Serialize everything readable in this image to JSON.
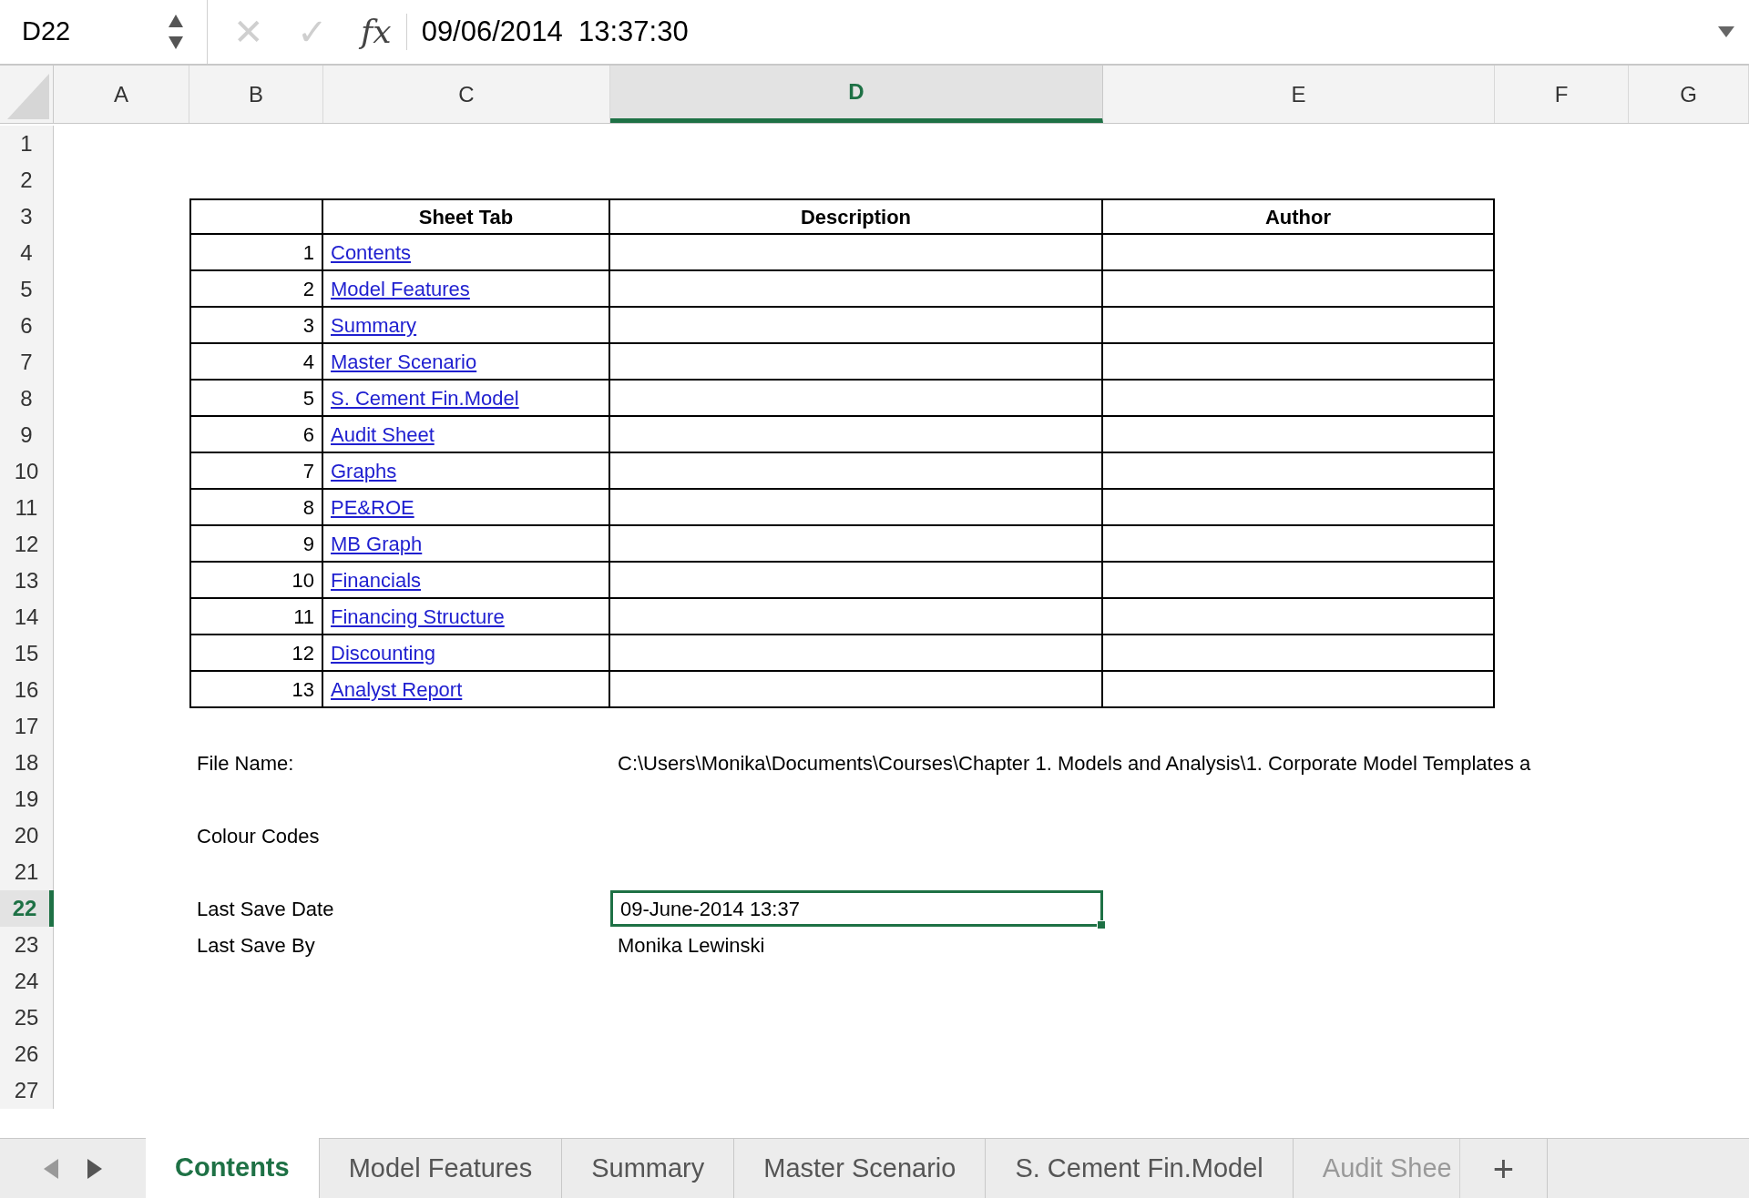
{
  "formula_bar": {
    "name_box": "D22",
    "cancel": "✕",
    "enter": "✓",
    "fx": "fx",
    "formula": "09/06/2014  13:37:30"
  },
  "columns": [
    {
      "label": "A",
      "selected": false
    },
    {
      "label": "B",
      "selected": false
    },
    {
      "label": "C",
      "selected": false
    },
    {
      "label": "D",
      "selected": true
    },
    {
      "label": "E",
      "selected": false
    },
    {
      "label": "F",
      "selected": false
    },
    {
      "label": "G",
      "selected": false
    }
  ],
  "row_numbers": [
    {
      "label": "1",
      "selected": false
    },
    {
      "label": "2",
      "selected": false
    },
    {
      "label": "3",
      "selected": false
    },
    {
      "label": "4",
      "selected": false
    },
    {
      "label": "5",
      "selected": false
    },
    {
      "label": "6",
      "selected": false
    },
    {
      "label": "7",
      "selected": false
    },
    {
      "label": "8",
      "selected": false
    },
    {
      "label": "9",
      "selected": false
    },
    {
      "label": "10",
      "selected": false
    },
    {
      "label": "11",
      "selected": false
    },
    {
      "label": "12",
      "selected": false
    },
    {
      "label": "13",
      "selected": false
    },
    {
      "label": "14",
      "selected": false
    },
    {
      "label": "15",
      "selected": false
    },
    {
      "label": "16",
      "selected": false
    },
    {
      "label": "17",
      "selected": false
    },
    {
      "label": "18",
      "selected": false
    },
    {
      "label": "19",
      "selected": false
    },
    {
      "label": "20",
      "selected": false
    },
    {
      "label": "21",
      "selected": false
    },
    {
      "label": "22",
      "selected": true
    },
    {
      "label": "23",
      "selected": false
    },
    {
      "label": "24",
      "selected": false
    },
    {
      "label": "25",
      "selected": false
    },
    {
      "label": "26",
      "selected": false
    },
    {
      "label": "27",
      "selected": false
    }
  ],
  "contents_table": {
    "headers": [
      "Sheet Tab",
      "Description",
      "Author"
    ],
    "rows": [
      {
        "number": "1",
        "sheet": "Contents"
      },
      {
        "number": "2",
        "sheet": "Model Features"
      },
      {
        "number": "3",
        "sheet": "Summary"
      },
      {
        "number": "4",
        "sheet": "Master Scenario"
      },
      {
        "number": "5",
        "sheet": "S. Cement Fin.Model"
      },
      {
        "number": "6",
        "sheet": "Audit Sheet"
      },
      {
        "number": "7",
        "sheet": "Graphs"
      },
      {
        "number": "8",
        "sheet": "PE&ROE"
      },
      {
        "number": "9",
        "sheet": "MB Graph"
      },
      {
        "number": "10",
        "sheet": "Financials"
      },
      {
        "number": "11",
        "sheet": "Financing Structure"
      },
      {
        "number": "12",
        "sheet": "Discounting"
      },
      {
        "number": "13",
        "sheet": "Analyst Report"
      }
    ]
  },
  "info": [
    {
      "label": "File Name:",
      "value": "C:\\Users\\Monika\\Documents\\Courses\\Chapter 1. Models and Analysis\\1. Corporate Model Templates a"
    },
    {
      "label": "Colour Codes"
    },
    {
      "label": "Last Save Date",
      "value": "09-June-2014 13:37",
      "selected": true
    },
    {
      "label": "Last Save By",
      "value": "Monika Lewinski"
    }
  ],
  "sheet_tabs": [
    {
      "label": "Contents",
      "selected": true
    },
    {
      "label": "Model Features",
      "selected": false
    },
    {
      "label": "Summary",
      "selected": false
    },
    {
      "label": "Master Scenario",
      "selected": false
    },
    {
      "label": "S. Cement Fin.Model",
      "selected": false
    },
    {
      "label": "Audit Shee",
      "selected": false,
      "faded": true
    }
  ],
  "add_sheet": "+"
}
